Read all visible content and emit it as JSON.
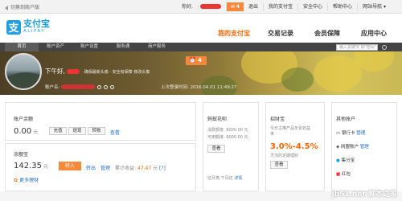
{
  "topbar": {
    "switch_label": "切换到商户版",
    "greeting": "你好,",
    "msg_count": "4",
    "logout": "退出",
    "my_alipay": "我的支付宝",
    "security": "安全中心",
    "help": "帮助中心",
    "site_nav": "网站导航"
  },
  "logo": {
    "mark": "支",
    "cn": "支付宝",
    "en": "ALIPAY"
  },
  "mainnav": [
    {
      "label": "我的支付宝"
    },
    {
      "label": "交易记录"
    },
    {
      "label": "会员保障"
    },
    {
      "label": "应用中心"
    }
  ],
  "subnav": {
    "tabs": [
      "首页",
      "账户资产",
      "账户设置",
      "服务通",
      "商户服务"
    ],
    "search_placeholder": "输入关键字,如\"密码\""
  },
  "banner": {
    "greeting": "下午好,",
    "greeting_links": "·确保最新头像 · 安全有保障 修改头像",
    "clock_count": "4",
    "account_label": "账户名:",
    "last_login_label": "上次登录时间:",
    "last_login_time": "2016.04.01 11:49:27"
  },
  "balance": {
    "title": "账户余额",
    "amount": "0.00",
    "unit": "元",
    "buttons": [
      "充值",
      "提现",
      "转账"
    ],
    "view": "查看"
  },
  "yuebao": {
    "title": "余额宝",
    "amount": "142.35",
    "unit": "元",
    "transfer_in": "转入",
    "transfer_out": "转出",
    "manage": "管理",
    "income_label": "累计收益:",
    "income": "47.47",
    "income_unit": "元",
    "more": "更多理财"
  },
  "huabei": {
    "title": "蚂蚁花呗",
    "line1": "消费额度: 8000.00 元",
    "line2": "可用额度: 8000.00 元",
    "view": "查看",
    "footer": "这月笑,下月还",
    "detail": "详情"
  },
  "zhaocaibao": {
    "title": "招财宝",
    "desc": "今日主推产品年化收益",
    "rate_label": "率",
    "rate": "3.0%-4.5%",
    "desc2": "灵活的定期理财",
    "view": "查看"
  },
  "others": {
    "title": "其他账户",
    "items": [
      {
        "name": "银行卡",
        "action": "管理"
      },
      {
        "name": "网盟账户",
        "action": "管理"
      },
      {
        "name": "集分宝",
        "action": ""
      },
      {
        "name": "红包",
        "action": ""
      }
    ]
  },
  "watermark": "jb51.net 脚本之家"
}
